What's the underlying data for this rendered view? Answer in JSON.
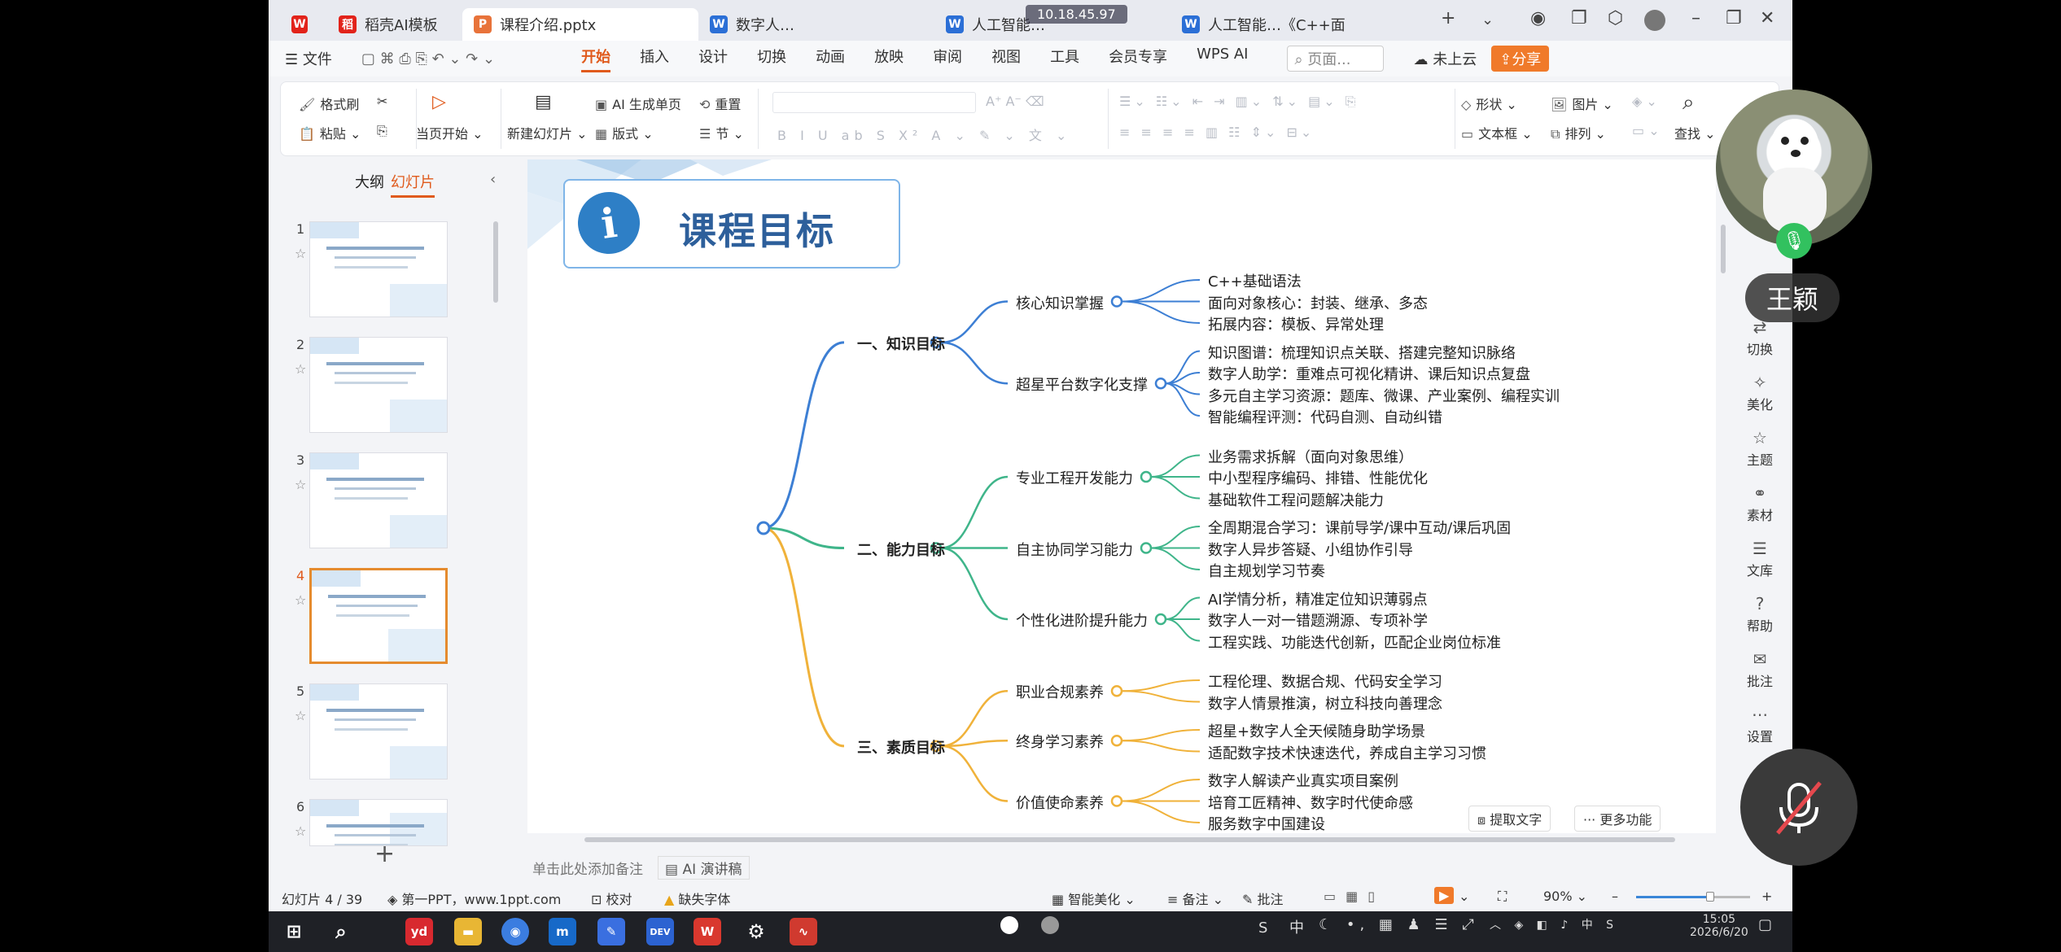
{
  "titlebar": {
    "tabs": [
      {
        "label": "",
        "badge": "W",
        "color": "#e2231a"
      },
      {
        "label": "稻壳AI模板",
        "badge": "稻",
        "color": "#e2231a"
      },
      {
        "label": "课程介绍.pptx",
        "badge": "P",
        "color": "#e8733a"
      },
      {
        "label": "数字人…",
        "badge": "W",
        "color": "#2b6fd6"
      },
      {
        "label": "人工智能…",
        "badge": "W",
        "color": "#2b6fd6"
      },
      {
        "label": "人工智能…《C++面",
        "badge": "W",
        "color": "#2b6fd6"
      }
    ],
    "watermark": "10.18.45.97"
  },
  "menubar": {
    "file": "文件",
    "items": [
      "开始",
      "插入",
      "设计",
      "切换",
      "动画",
      "放映",
      "审阅",
      "视图",
      "工具",
      "会员专享",
      "WPS AI"
    ],
    "active": "开始",
    "search_placeholder": "页面...",
    "cloud": "未上云",
    "share": "分享"
  },
  "ribbon": {
    "format_brush": "格式刷",
    "paste": "粘贴",
    "play_from_current": "当页开始",
    "new_slide": "新建幻灯片",
    "ai_generate": "AI 生成单页",
    "layout": "版式",
    "reset": "重置",
    "section": "节",
    "shape": "形状",
    "picture": "图片",
    "textbox": "文本框",
    "arrange": "排列",
    "find": "查找"
  },
  "leftpanel": {
    "tab_outline": "大纲",
    "tab_slides": "幻灯片",
    "slides": [
      "1",
      "2",
      "3",
      "4",
      "5",
      "6"
    ],
    "selected": "4"
  },
  "slide": {
    "title": "课程目标",
    "icon": "info-icon",
    "root_color": "#3d7fd4",
    "branches": [
      {
        "label": "一、知识目标",
        "color": "#3d7fd4",
        "children": [
          {
            "label": "核心知识掌握",
            "leaves": [
              "C++基础语法",
              "面向对象核心：封装、继承、多态",
              "拓展内容：模板、异常处理"
            ]
          },
          {
            "label": "超星平台数字化支撑",
            "leaves": [
              "知识图谱：梳理知识点关联、搭建完整知识脉络",
              "数字人助学：重难点可视化精讲、课后知识点复盘",
              "多元自主学习资源：题库、微课、产业案例、编程实训",
              "智能编程评测：代码自测、自动纠错"
            ]
          }
        ]
      },
      {
        "label": "二、能力目标",
        "color": "#3fb58a",
        "children": [
          {
            "label": "专业工程开发能力",
            "leaves": [
              "业务需求拆解（面向对象思维）",
              "中小型程序编码、排错、性能优化",
              "基础软件工程问题解决能力"
            ]
          },
          {
            "label": "自主协同学习能力",
            "leaves": [
              "全周期混合学习：课前导学/课中互动/课后巩固",
              "数字人异步答疑、小组协作引导",
              "自主规划学习节奏"
            ]
          },
          {
            "label": "个性化进阶提升能力",
            "leaves": [
              "AI学情分析，精准定位知识薄弱点",
              "数字人一对一错题溯源、专项补学",
              "工程实践、功能迭代创新，匹配企业岗位标准"
            ]
          }
        ]
      },
      {
        "label": "三、素质目标",
        "color": "#f0b23a",
        "children": [
          {
            "label": "职业合规素养",
            "leaves": [
              "工程伦理、数据合规、代码安全学习",
              "数字人情景推演，树立科技向善理念"
            ]
          },
          {
            "label": "终身学习素养",
            "leaves": [
              "超星+数字人全天候随身助学场景",
              "适配数字技术快速迭代，养成自主学习习惯"
            ]
          },
          {
            "label": "价值使命素养",
            "leaves": [
              "数字人解读产业真实项目案例",
              "培育工匠精神、数字时代使命感",
              "服务数字中国建设"
            ]
          }
        ]
      }
    ],
    "extract_text": "提取文字",
    "more_features": "更多功能"
  },
  "righttools": [
    "切换",
    "美化",
    "主题",
    "素材",
    "文库",
    "帮助",
    "批注",
    "设置"
  ],
  "notes": {
    "placeholder": "单击此处添加备注",
    "ai_script": "AI 演讲稿"
  },
  "status": {
    "slide_counter": "幻灯片 4 / 39",
    "theme": "第一PPT，www.1ppt.com",
    "proofread": "校对",
    "missing_font": "缺失字体",
    "smart_beautify": "智能美化",
    "notes": "备注",
    "comments": "批注",
    "zoom": "90%"
  },
  "video": {
    "name": "王颖"
  },
  "taskbar": {
    "ime": "中",
    "time": "15:05",
    "date": "2026/6/20"
  }
}
